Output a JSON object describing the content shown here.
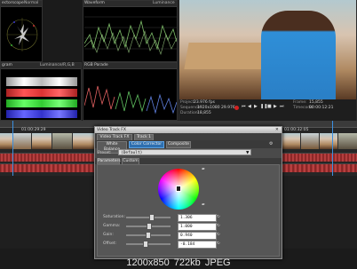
{
  "scopes": {
    "vectorscope_title": "ectorscope",
    "vectorscope_mode": "Normal",
    "waveform_title": "Waveform",
    "waveform_mode": "Luminance",
    "histogram_title": "gram",
    "histogram_mode": "Luminance/R,G,B",
    "parade_title": "RGB Parade"
  },
  "monitor": {
    "project_label": "Project:",
    "project_value": "23.976 fps",
    "sequence_label": "Sequence:",
    "sequence_value": "1920x1080 29.976",
    "duration_label": "Duration:",
    "duration_value": "18,855",
    "frame_label": "Frame:",
    "frame_value": "15,855",
    "tc_label": "Timecode:",
    "tc_value": "00:00:12:21"
  },
  "timeline": {
    "tc_left": "01:00:29:29",
    "tc_right": "01:00:32:05"
  },
  "fx_window": {
    "title": "Video Track FX",
    "track_tab": "Video Track FX",
    "track_select": "Track 1",
    "plugin_white_balance": "White Balance",
    "plugin_color_corrector": "Color Corrector",
    "plugin_composite": "Composite",
    "preset_label": "Preset:",
    "preset_value": "(Default)",
    "tab_parameters": "Parameters",
    "tab_custom": "Custom",
    "params": [
      {
        "label": "Saturation:",
        "value": "1.306",
        "level": 0.55
      },
      {
        "label": "Gamma:",
        "value": "1.000",
        "level": 0.5
      },
      {
        "label": "Gain:",
        "value": "0.940",
        "level": 0.47
      },
      {
        "label": "Offset:",
        "value": "-0.184",
        "level": 0.42
      }
    ]
  },
  "footer": {
    "resolution": "1200x850",
    "filesize": "722kb",
    "format": "JPEG"
  }
}
